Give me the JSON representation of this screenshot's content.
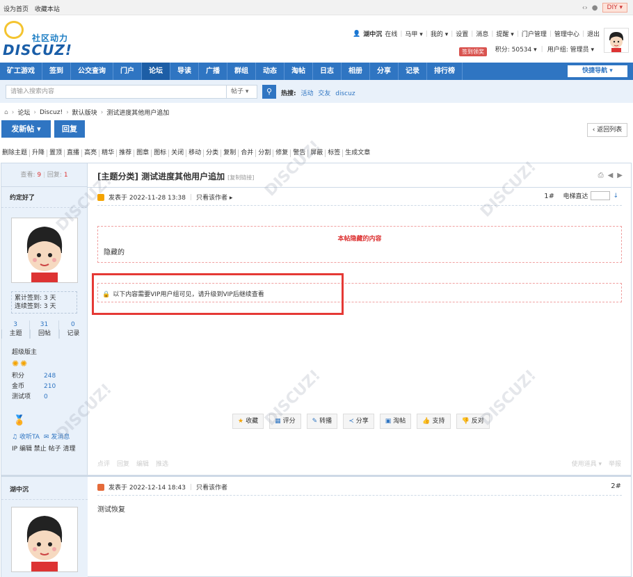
{
  "topbar": {
    "set_home": "设为首页",
    "bookmark": "收藏本站",
    "diy": "DIY"
  },
  "logo": {
    "sub": "社区动力",
    "main": "DISCUZ!"
  },
  "user": {
    "name": "湖中沉",
    "status": "在线",
    "links": [
      "马甲",
      "我的",
      "设置",
      "消息",
      "提醒",
      "门户管理",
      "管理中心",
      "退出"
    ],
    "signin_badge": "签到领奖",
    "points": "积分: 50534",
    "group": "用户组: 管理员"
  },
  "nav": {
    "items": [
      "矿工游戏",
      "签到",
      "公交查询",
      "门户",
      "论坛",
      "导读",
      "广播",
      "群组",
      "动态",
      "淘帖",
      "日志",
      "相册",
      "分享",
      "记录",
      "排行榜"
    ],
    "active": "论坛",
    "quick": "快捷导航"
  },
  "search": {
    "placeholder": "请输入搜索内容",
    "type": "帖子",
    "hot_label": "热搜:",
    "hot": [
      "活动",
      "交友",
      "discuz"
    ]
  },
  "breadcrumb": [
    "论坛",
    "Discuz!",
    "默认版块",
    "测试进度其他用户追加"
  ],
  "buttons": {
    "new_post": "发新帖",
    "reply": "回复",
    "back": "返回列表"
  },
  "mod_tools": [
    "删除主题",
    "升降",
    "置顶",
    "直播",
    "高亮",
    "精华",
    "推荐",
    "图章",
    "图标",
    "关闭",
    "移动",
    "分类",
    "复制",
    "合并",
    "分割",
    "修复",
    "警告",
    "屏蔽",
    "标签",
    "生成文章"
  ],
  "thread": {
    "views_label": "查看:",
    "views": "9",
    "replies_label": "回复:",
    "replies": "1",
    "title": "[主题分类] 测试进度其他用户追加",
    "copy_link": "[复制链接]"
  },
  "post1": {
    "author": "约定好了",
    "signin": [
      "累计签到: 3 天",
      "连续签到: 3 天"
    ],
    "counts": [
      {
        "n": "3",
        "label": "主题"
      },
      {
        "n": "31",
        "label": "回帖"
      },
      {
        "n": "0",
        "label": "记录"
      }
    ],
    "group": "超级版主",
    "stats": [
      {
        "k": "积分",
        "v": "248"
      },
      {
        "k": "金币",
        "v": "210"
      },
      {
        "k": "测试项",
        "v": "0"
      }
    ],
    "follow": "收听TA",
    "message": "发消息",
    "admin": "IP 编辑 禁止 帖子 清理",
    "posted": "发表于 2022-11-28 13:38",
    "only_author": "只看该作者",
    "floor": "1#",
    "jump_label": "电梯直达",
    "hidden_title": "本帖隐藏的内容",
    "hidden_content": "隐藏的",
    "vip_notice": "以下内容需要VIP用户组可见，请升级到VIP后继续查看",
    "actions": [
      "收藏",
      "评分",
      "转播",
      "分享",
      "淘帖",
      "支持",
      "反对"
    ],
    "ops": [
      "点评",
      "回复",
      "编辑",
      "推选"
    ],
    "ops_right": [
      "使用道具",
      "举报"
    ]
  },
  "post2": {
    "author": "湖中沉",
    "posted": "发表于 2022-12-14 18:43",
    "only_author": "只看该作者",
    "floor": "2#",
    "content": "测试恢复"
  }
}
